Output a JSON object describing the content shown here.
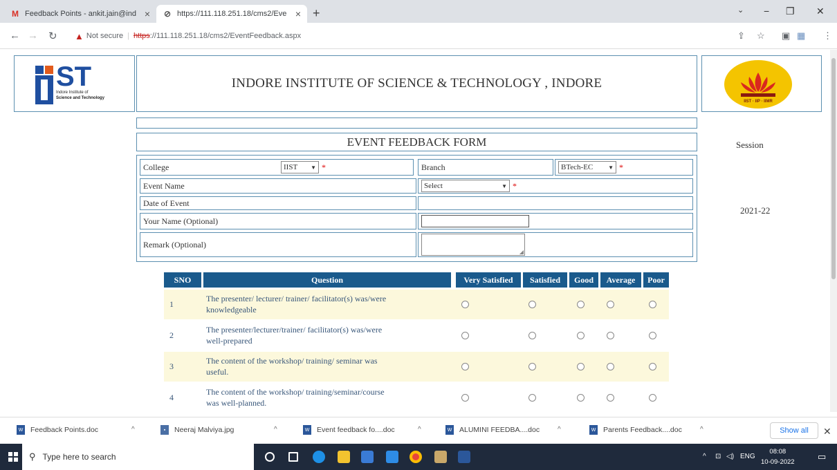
{
  "browser": {
    "tabs": [
      {
        "title": "Feedback Points - ankit.jain@ind"
      },
      {
        "title": "https://111.118.251.18/cms2/Eve"
      }
    ],
    "new_tab": "+",
    "security_label": "Not secure",
    "url_scheme": "https",
    "url_rest": "://111.118.251.18/cms2/EventFeedback.aspx"
  },
  "header": {
    "institute_name": "INDORE INSTITUTE OF SCIENCE & TECHNOLOGY , INDORE",
    "logo_left_text": "ST",
    "logo_left_sub1": "Indore Institute of",
    "logo_left_sub2": "Science and Technology",
    "logo_right_caption": "IIST · IIP · IIMR"
  },
  "form": {
    "title": "EVENT FEEDBACK FORM",
    "session_label": "Session",
    "session_value": "2021-22",
    "college_label": "College",
    "college_value": "IIST",
    "branch_label": "Branch",
    "branch_value": "BTech-EC",
    "event_name_label": "Event Name",
    "event_name_value": "Select",
    "date_label": "Date of Event",
    "name_label": "Your Name (Optional)",
    "remark_label": "Remark (Optional)",
    "required_mark": "*"
  },
  "table": {
    "headers": {
      "sno": "SNO",
      "question": "Question",
      "very_satisfied": "Very Satisfied",
      "satisfied": "Satisfied",
      "good": "Good",
      "average": "Average",
      "poor": "Poor"
    },
    "rows": [
      {
        "sno": "1",
        "q1": "The presenter/ lecturer/ trainer/ facilitator(s) was/were",
        "q2": "knowledgeable"
      },
      {
        "sno": "2",
        "q1": "The presenter/lecturer/trainer/ facilitator(s) was/were",
        "q2": "well-prepared"
      },
      {
        "sno": "3",
        "q1": "The content of the workshop/ training/ seminar was",
        "q2": "useful."
      },
      {
        "sno": "4",
        "q1": "The content of the workshop/ training/seminar/course",
        "q2": "was well-planned."
      }
    ]
  },
  "downloads": {
    "items": [
      {
        "name": "Feedback Points.doc"
      },
      {
        "name": "Neeraj Malviya.jpg"
      },
      {
        "name": "Event feedback fo....doc"
      },
      {
        "name": "ALUMINI FEEDBA....doc"
      },
      {
        "name": "Parents Feedback....doc"
      }
    ],
    "show_all": "Show all"
  },
  "taskbar": {
    "search_placeholder": "Type here to search",
    "language": "ENG",
    "time": "08:08",
    "date": "10-09-2022"
  },
  "colors": {
    "table_header": "#1a5a8c",
    "row_shade": "#fcf8dc",
    "border": "#5b8fb0",
    "taskbar": "#1f2a3c"
  }
}
